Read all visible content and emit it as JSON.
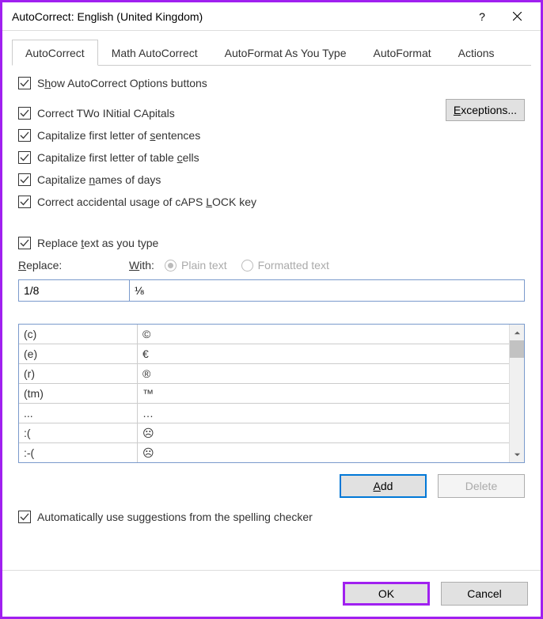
{
  "window": {
    "title": "AutoCorrect: English (United Kingdom)",
    "help": "?",
    "close": "×"
  },
  "tabs": {
    "autocorrect": "AutoCorrect",
    "math": "Math AutoCorrect",
    "autoformat_type": "AutoFormat As You Type",
    "autoformat": "AutoFormat",
    "actions": "Actions"
  },
  "options": {
    "show_buttons": "Show AutoCorrect Options buttons",
    "two_initial": "Correct TWo INitial CApitals",
    "first_sentence": "Capitalize first letter of sentences",
    "first_table": "Capitalize first letter of table cells",
    "names_days": "Capitalize names of days",
    "caps_lock": "Correct accidental usage of cAPS LOCK key",
    "replace_type": "Replace text as you type",
    "spell_suggest": "Automatically use suggestions from the spelling checker"
  },
  "buttons": {
    "exceptions": "Exceptions...",
    "add": "Add",
    "delete": "Delete",
    "ok": "OK",
    "cancel": "Cancel"
  },
  "labels": {
    "replace": "Replace:",
    "with": "With:",
    "plain": "Plain text",
    "formatted": "Formatted text"
  },
  "inputs": {
    "replace_value": "1/8",
    "with_value": "⅛"
  },
  "table": [
    {
      "from": "(c)",
      "to": "©"
    },
    {
      "from": "(e)",
      "to": "€"
    },
    {
      "from": "(r)",
      "to": "®"
    },
    {
      "from": "(tm)",
      "to": "™"
    },
    {
      "from": "...",
      "to": "…"
    },
    {
      "from": ":(",
      "to": "☹"
    },
    {
      "from": ":-(",
      "to": "☹"
    }
  ]
}
